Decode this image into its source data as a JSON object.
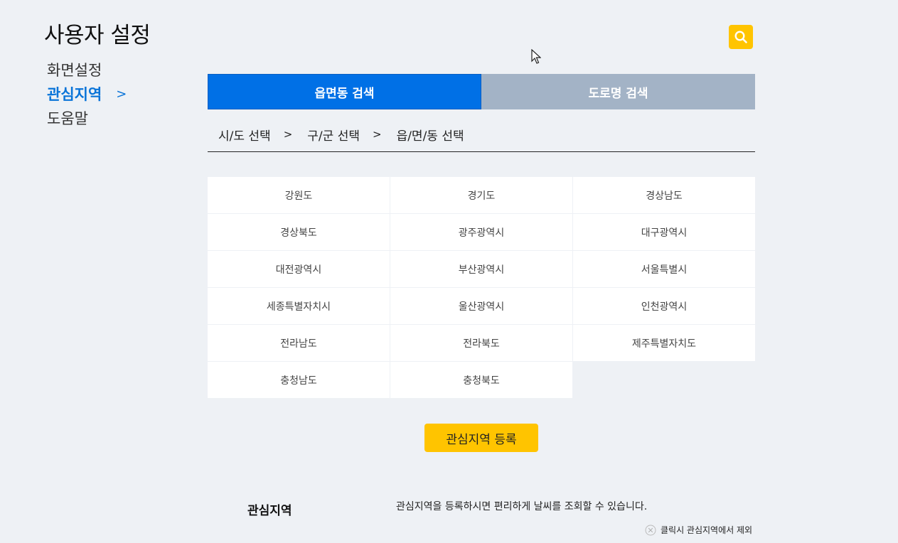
{
  "page": {
    "title": "사용자 설정"
  },
  "sidebar": {
    "items": [
      {
        "label": "화면설정"
      },
      {
        "label": "관심지역",
        "active": true,
        "chevron": ">"
      },
      {
        "label": "도움말"
      }
    ]
  },
  "search": {
    "icon": "search-icon"
  },
  "tabs": [
    {
      "label": "읍면동 검색",
      "active": true
    },
    {
      "label": "도로명 검색",
      "active": false
    }
  ],
  "breadcrumb": {
    "steps": [
      "시/도 선택",
      "구/군 선택",
      "읍/면/동 선택"
    ],
    "separator": ">"
  },
  "regions": [
    "강원도",
    "경기도",
    "경상남도",
    "경상북도",
    "광주광역시",
    "대구광역시",
    "대전광역시",
    "부산광역시",
    "서울특별시",
    "세종특별자치시",
    "울산광역시",
    "인천광역시",
    "전라남도",
    "전라북도",
    "제주특별자치도",
    "충청남도",
    "충청북도"
  ],
  "register_button": {
    "label": "관심지역 등록"
  },
  "favorites": {
    "label": "관심지역",
    "description": "관심지역을 등록하시면 편리하게 날씨를 조회할 수 있습니다.",
    "hint": "클릭시 관심지역에서 제외"
  },
  "colors": {
    "accent_blue": "#0070e6",
    "inactive_tab": "#a3b3c6",
    "yellow": "#ffc400",
    "background": "#eef1f5"
  }
}
